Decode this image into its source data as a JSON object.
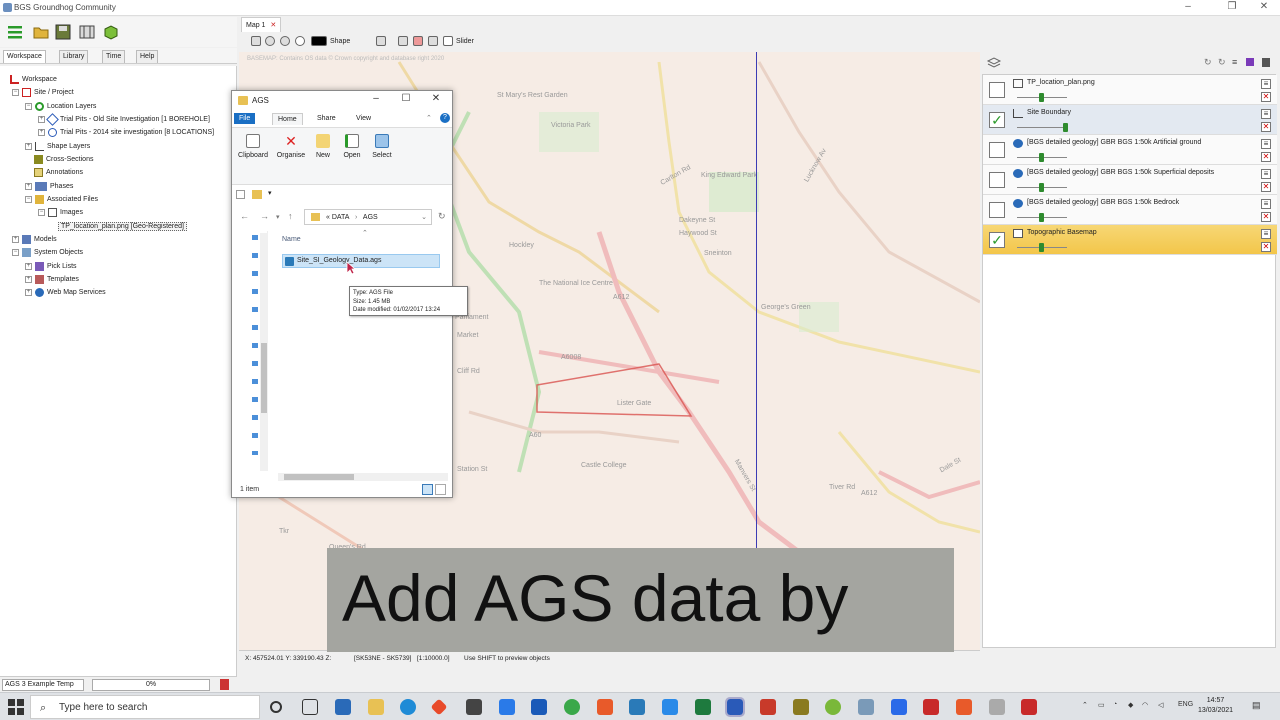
{
  "app": {
    "title": "BGS Groundhog Community"
  },
  "window_controls": {
    "minimize": "–",
    "restore": "❐",
    "close": "✕"
  },
  "left_tabs": [
    "Workspace",
    "Library",
    "Time",
    "Help"
  ],
  "tree": {
    "workspace": "Workspace",
    "site_project": "Site / Project",
    "location_layers": "Location Layers",
    "trial_pits_old": "Trial Pits - Old Site Investigation [1 BOREHOLE]",
    "trial_pits_2014": "Trial Pits - 2014 site investigation [8 LOCATIONS]",
    "shape_layers": "Shape Layers",
    "cross_sections": "Cross-Sections",
    "annotations": "Annotations",
    "phases": "Phases",
    "associated_files": "Associated Files",
    "images": "Images",
    "tp_location_plan": "TP_location_plan.png [Geo-Registered]",
    "models": "Models",
    "system_objects": "System Objects",
    "pick_lists": "Pick Lists",
    "templates": "Templates",
    "web_map_services": "Web Map Services"
  },
  "bottom_left": {
    "template": "AGS 3 Example Temp",
    "progress": "0%"
  },
  "map_tab": {
    "label": "Map 1",
    "close": "✕"
  },
  "map_toolbar": {
    "shape_label": "Shape",
    "slider_label": "Slider"
  },
  "map": {
    "credit": "BASEMAP: Contains OS data © Crown copyright and database right 2020",
    "labels": [
      "St Mary's Rest Garden",
      "Victoria Park",
      "King Edward Park",
      "Sneinton",
      "Hockley",
      "The National Ice Centre",
      "A612",
      "A60",
      "A6008",
      "Castle College",
      "Station St",
      "Queen's Rd",
      "George's Green",
      "Lister Gate",
      "Tiver Rd",
      "Cliff Rd",
      "Market",
      "Manvers St",
      "Carlton Rd",
      "A612",
      "Dakeyne St",
      "Haywood St",
      "Lucknow Av",
      "Dale St",
      "Parliament",
      "Tkr"
    ]
  },
  "status": {
    "coords": "X: 457524.01  Y: 339190.43  Z:",
    "sheet": "[SK53NE - SK5739]",
    "scale": "[1:10000.0]",
    "hint": "Use SHIFT to preview objects"
  },
  "layers": [
    {
      "name": "TP_location_plan.png",
      "checked": false
    },
    {
      "name": "Site Boundary",
      "checked": true
    },
    {
      "name": "[BGS detailed geology] GBR BGS 1:50k Artificial ground",
      "checked": false
    },
    {
      "name": "[BGS detailed geology] GBR BGS 1:50k Superficial deposits",
      "checked": false
    },
    {
      "name": "[BGS detailed geology] GBR BGS 1:50k Bedrock",
      "checked": false
    },
    {
      "name": "Topographic Basemap",
      "checked": true
    }
  ],
  "explorer": {
    "title": "AGS",
    "ribbon_tabs": [
      "File",
      "Home",
      "Share",
      "View"
    ],
    "ribbon_buttons": [
      "Clipboard",
      "Organise",
      "New",
      "Open",
      "Select"
    ],
    "path": [
      "DATA",
      "AGS"
    ],
    "path_prefix": "«",
    "column_name": "Name",
    "file": "Site_SI_Geology_Data.ags",
    "tooltip": {
      "type": "Type: AGS File",
      "size": "Size: 1.45 MB",
      "modified": "Date modified: 01/02/2017 13:24"
    },
    "status": "1 item"
  },
  "caption": "Add AGS data by",
  "taskbar": {
    "search_placeholder": "Type here to search",
    "lang": "ENG",
    "time": "14:57",
    "date": "13/03/2021"
  },
  "colors": {
    "accent_blue": "#1a6fc4",
    "site_boundary": "#d9534f",
    "slider_line": "#3c3cb4",
    "highlight_layer": "#f3c64a"
  }
}
